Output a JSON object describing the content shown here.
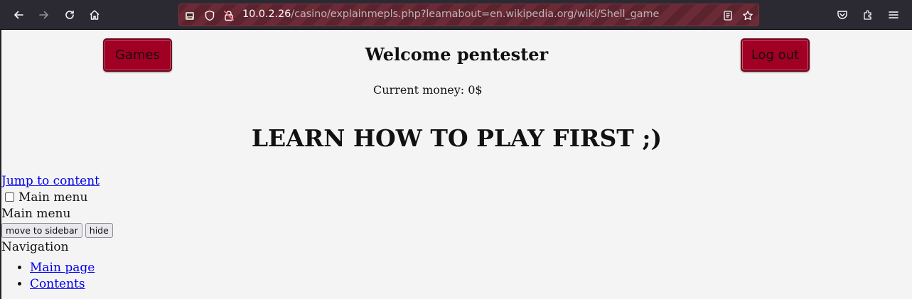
{
  "browser": {
    "url_host": "10.0.2.26",
    "url_path": "/casino/explainmepls.php?learnabout=en.wikipedia.org/wiki/Shell_game"
  },
  "header": {
    "games_label": "Games",
    "welcome": "Welcome pentester",
    "logout_label": "Log out",
    "money": "Current money: 0$"
  },
  "main": {
    "heading": "LEARN HOW TO PLAY FIRST ;)"
  },
  "wiki": {
    "jump_link": "Jump to content",
    "main_menu_checkbox_label": "Main menu",
    "main_menu_heading": "Main menu",
    "move_to_sidebar": "move to sidebar",
    "hide": "hide",
    "navigation_heading": "Navigation",
    "nav_items": [
      "Main page",
      "Contents"
    ]
  }
}
